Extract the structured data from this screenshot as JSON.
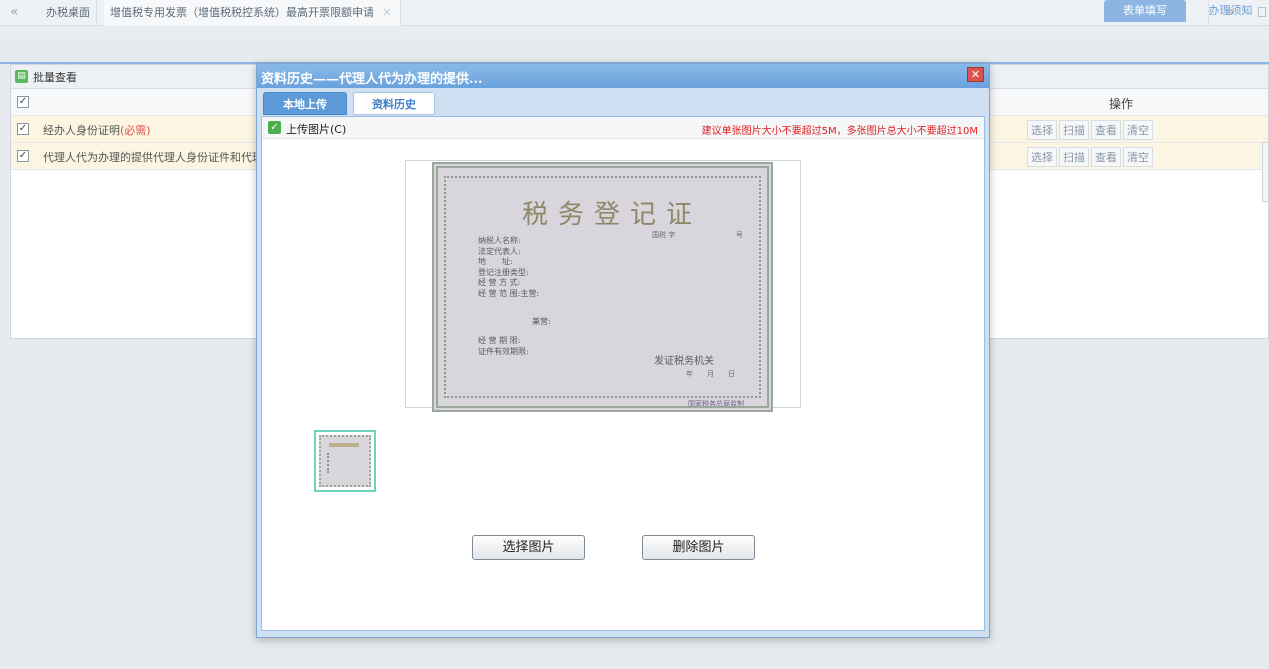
{
  "topbar": {
    "tabs": [
      "办税桌面",
      "增值税专用发票（增值税税控系统）最高开票限额申请"
    ],
    "close_glyph": "×"
  },
  "right_tabs": [
    "表单填写",
    "办理须知"
  ],
  "grid": {
    "batch_label": "批量查看",
    "ops_header": "操作",
    "rows": [
      {
        "label": "经办人身份证明",
        "required": "(必需)"
      },
      {
        "label": "代理人代为办理的提供代理人身份证件和代理",
        "required": ""
      }
    ],
    "ops": [
      "选择",
      "扫描",
      "查看",
      "清空"
    ]
  },
  "dialog": {
    "title": "资料历史——代理人代为办理的提供...",
    "tabs": [
      "本地上传",
      "资料历史"
    ],
    "upload_label": "上传图片(C)",
    "upload_hint": "建议单张图片大小不要超过5M，多张图片总大小不要超过10M",
    "buttons": {
      "select": "选择图片",
      "delete": "删除图片"
    }
  },
  "certificate": {
    "title": "税务登记证",
    "number_prefix": "国税 字",
    "number_suffix": "号",
    "fields": [
      "纳税人名称:",
      "法定代表人:",
      "地　　址:",
      "登记注册类型:",
      "经 营 方 式:",
      "经 营 范 围:主营:"
    ],
    "sub_field": "兼营:",
    "extra_fields": [
      "经 营 期 限:",
      "证件有效期限:"
    ],
    "issuer": "发证税务机关",
    "date": "年　　月　　日",
    "stamp": "国家税务总局监制"
  },
  "icons": {
    "nav_prev": "«",
    "nav_next": "»",
    "dialog_close": "close-icon",
    "batch": "batch-view-icon",
    "upload_check": "check-icon"
  },
  "colors": {
    "dialog_title": "#7db0e4",
    "active_tab": "#5c9ad8",
    "hint_text": "#e02020",
    "row_highlight": "#fbf5e2"
  }
}
